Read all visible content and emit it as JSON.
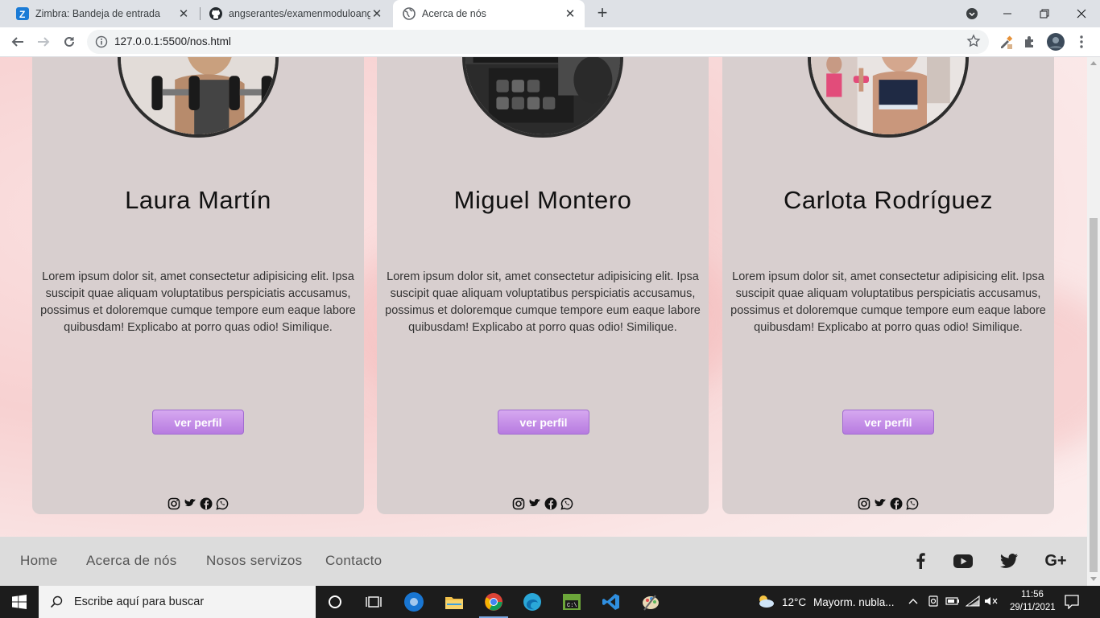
{
  "browser": {
    "tabs": [
      {
        "title": "Zimbra: Bandeja de entrada",
        "icon": "zimbra-icon",
        "active": false
      },
      {
        "title": "angserantes/examenmoduloange",
        "icon": "github-icon",
        "active": false
      },
      {
        "title": "Acerca de nós",
        "icon": "globe-icon",
        "active": true
      }
    ],
    "url": "127.0.0.1:5500/nos.html"
  },
  "cards": [
    {
      "name": "Laura Martín",
      "description": "Lorem ipsum dolor sit, amet consectetur adipisicing elit. Ipsa suscipit quae aliquam voluptatibus perspiciatis accusamus, possimus et doloremque cumque tempore eum eaque labore quibusdam! Explicabo at porro quas odio! Similique.",
      "button": "ver perfil"
    },
    {
      "name": "Miguel Montero",
      "description": "Lorem ipsum dolor sit, amet consectetur adipisicing elit. Ipsa suscipit quae aliquam voluptatibus perspiciatis accusamus, possimus et doloremque cumque tempore eum eaque labore quibusdam! Explicabo at porro quas odio! Similique.",
      "button": "ver perfil"
    },
    {
      "name": "Carlota Rodríguez",
      "description": "Lorem ipsum dolor sit, amet consectetur adipisicing elit. Ipsa suscipit quae aliquam voluptatibus perspiciatis accusamus, possimus et doloremque cumque tempore eum eaque labore quibusdam! Explicabo at porro quas odio! Similique.",
      "button": "ver perfil"
    }
  ],
  "social_icons": [
    "instagram-icon",
    "twitter-icon",
    "facebook-icon",
    "whatsapp-icon"
  ],
  "footer": {
    "links": [
      "Home",
      "Acerca de nós",
      "Nosos servizos",
      "Contacto"
    ],
    "social": [
      "facebook-icon",
      "youtube-icon",
      "twitter-icon",
      "google-plus-icon"
    ],
    "gplus_label": "G+"
  },
  "taskbar": {
    "search_placeholder": "Escribe aquí para buscar",
    "weather_temp": "12°C",
    "weather_text": "Mayorm. nubla...",
    "time": "11:56",
    "date": "29/11/2021"
  },
  "colors": {
    "card_bg": "#d8cfcf",
    "button": "#c48ce8",
    "page_bg": "#f7d1d1",
    "footer_bg": "#dcdcdc"
  }
}
